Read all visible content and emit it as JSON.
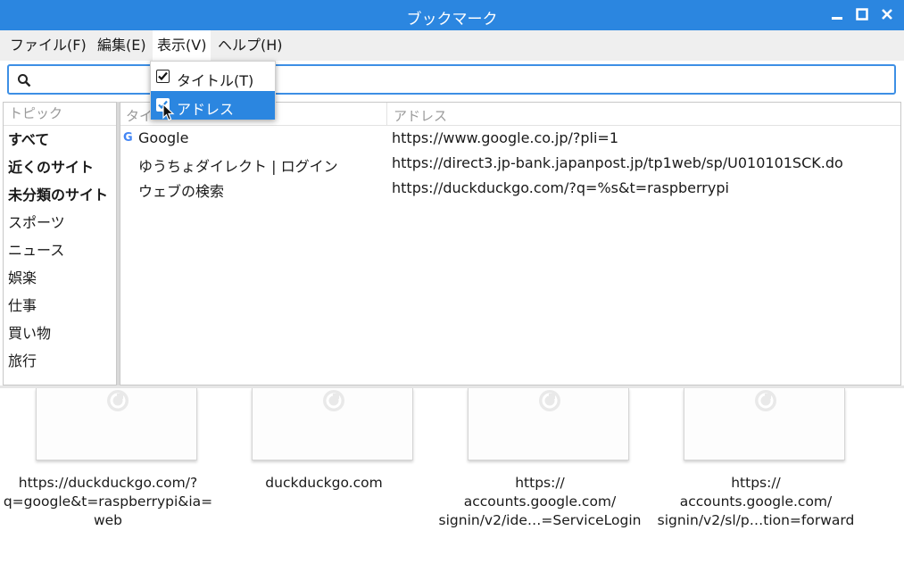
{
  "window": {
    "title": "ブックマーク"
  },
  "menu": {
    "items": [
      "ファイル(F)",
      "編集(E)",
      "表示(V)",
      "ヘルプ(H)"
    ],
    "open_menu": {
      "items": [
        {
          "label": "タイトル(T)",
          "checked": true
        },
        {
          "label": "アドレス",
          "checked": true
        }
      ]
    }
  },
  "search": {
    "value": "",
    "placeholder": "",
    "icon": "search-icon"
  },
  "topics": {
    "header": "トピック",
    "items": [
      "すべて",
      "近くのサイト",
      "未分類のサイト",
      "スポーツ",
      "ニュース",
      "娯楽",
      "仕事",
      "買い物",
      "旅行"
    ]
  },
  "bookmarks": {
    "headers": {
      "title": "タイ",
      "address": "アドレス"
    },
    "rows": [
      {
        "title": "Google",
        "icon": "G",
        "address": "https://www.google.co.jp/?pli=1"
      },
      {
        "title": "ゆうちょダイレクト | ログイン",
        "address": "https://direct3.jp-bank.japanpost.jp/tp1web/sp/U010101SCK.do"
      },
      {
        "title": "ウェブの検索",
        "address": "https://duckduckgo.com/?q=%s&t=raspberrypi"
      }
    ]
  },
  "thumbnails": [
    {
      "lines": [
        "https://duckduckgo.com/?",
        "q=google&t=raspberrypi&ia=",
        "web"
      ]
    },
    {
      "lines": [
        "duckduckgo.com"
      ]
    },
    {
      "lines": [
        "https://",
        "accounts.google.com/",
        "signin/v2/ide…=ServiceLogin"
      ]
    },
    {
      "lines": [
        "https://",
        "accounts.google.com/",
        "signin/v2/sl/p…tion=forward"
      ]
    }
  ],
  "colors": {
    "titlebar": "#2b86e0",
    "accent": "#3d8fe5",
    "highlight": "#2b86e0"
  }
}
